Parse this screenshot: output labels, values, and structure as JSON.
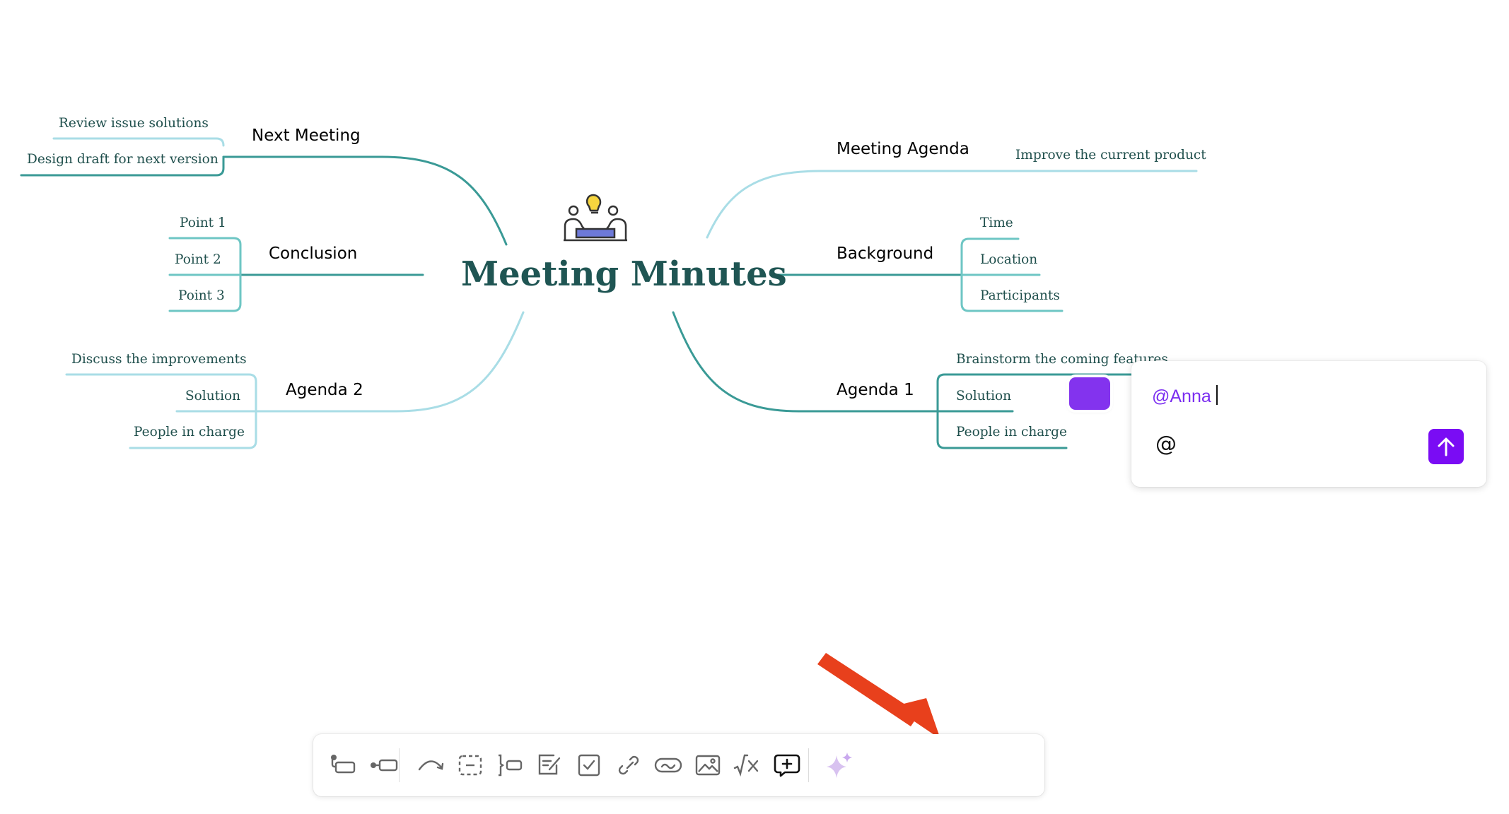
{
  "center": {
    "title": "Meeting Minutes",
    "icon": "meeting-people-lightbulb-icon"
  },
  "branches": {
    "next_meeting": {
      "label": "Next Meeting",
      "items": [
        "Review issue solutions",
        "Design draft for next version"
      ]
    },
    "conclusion": {
      "label": "Conclusion",
      "items": [
        "Point 1",
        "Point 2",
        "Point 3"
      ]
    },
    "agenda2": {
      "label": "Agenda 2",
      "items": [
        "Discuss the improvements",
        "Solution",
        "People in charge"
      ]
    },
    "meeting_agenda": {
      "label": "Meeting Agenda",
      "items": [
        "Improve the current product"
      ]
    },
    "background": {
      "label": "Background",
      "items": [
        "Time",
        "Location",
        "Participants"
      ]
    },
    "agenda1": {
      "label": "Agenda 1",
      "items": [
        "Brainstorm the coming features",
        "Solution",
        "People in charge"
      ]
    }
  },
  "comment": {
    "mention": "@Anna",
    "at_symbol": "@",
    "send_icon": "arrow-up-icon"
  },
  "toolbar": {
    "tools": [
      "insert-child-icon",
      "insert-sibling-icon",
      "relationship-icon",
      "boundary-icon",
      "summary-icon",
      "note-icon",
      "task-icon",
      "link-icon",
      "embed-link-icon",
      "image-icon",
      "equation-icon",
      "comment-icon",
      "ai-sparkle-icon"
    ]
  },
  "colors": {
    "branch_dark": "#3a9a96",
    "branch_light": "#a9dde6",
    "accent": "#7a0cf4",
    "pointer_arrow": "#e8401c"
  }
}
